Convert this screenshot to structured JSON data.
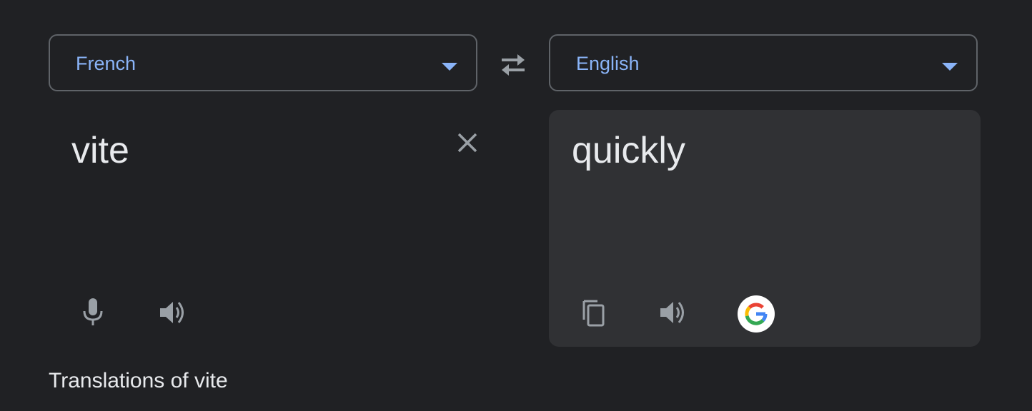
{
  "source": {
    "language": "French",
    "text": "vite"
  },
  "target": {
    "language": "English",
    "text": "quickly"
  },
  "translations_heading": "Translations of vite",
  "icons": {
    "caret": "triangle-down",
    "swap": "swap-arrows-icon",
    "clear": "close-icon",
    "mic": "microphone-icon",
    "speaker": "speaker-icon",
    "copy": "copy-icon",
    "google": "google-logo-icon"
  },
  "colors": {
    "background": "#202124",
    "panel": "#303134",
    "accent": "#8ab4f8",
    "text": "#e8eaed",
    "icon": "#9aa0a6",
    "border": "#5f6368"
  }
}
